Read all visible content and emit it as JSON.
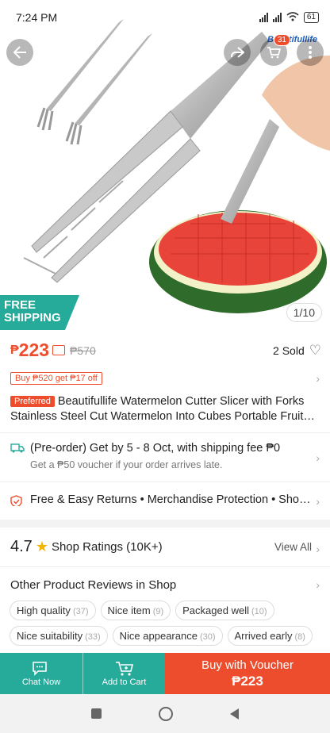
{
  "status_bar": {
    "time": "7:24 PM",
    "battery": "61"
  },
  "header": {
    "cart_count": "31",
    "brand_logo": "Beautifullife"
  },
  "hero": {
    "free_shipping_line1": "FREE",
    "free_shipping_line2": "SHIPPING",
    "image_counter": "1/10"
  },
  "price": {
    "currency": "₱",
    "current": "223",
    "original": "₱570",
    "sold": "2 Sold"
  },
  "voucher_tag": "Buy ₱520 get ₱17 off",
  "product": {
    "badge": "Preferred",
    "title": "Beautifullife Watermelon Cutter Slicer with Forks Stainless Steel Cut Watermelon Into Cubes Portable Fruit Slicer"
  },
  "shipping": {
    "main": "(Pre-order) Get by 5 - 8 Oct, with shipping fee ₱0",
    "sub": "Get a ₱50 voucher if your order arrives late."
  },
  "guarantee": {
    "text": "Free & Easy Returns  •  Merchandise Protection  •  Shopee Guarantee"
  },
  "shop_ratings": {
    "value": "4.7",
    "label": "Shop Ratings (10K+)",
    "view_all": "View All"
  },
  "reviews": {
    "title": "Other Product Reviews in Shop",
    "chips": [
      {
        "label": "High quality",
        "count": "(37)"
      },
      {
        "label": "Nice item",
        "count": "(9)"
      },
      {
        "label": "Packaged well",
        "count": "(10)"
      },
      {
        "label": "Nice suitability",
        "count": "(33)"
      },
      {
        "label": "Nice appearance",
        "count": "(30)"
      },
      {
        "label": "Arrived early",
        "count": "(8)"
      }
    ]
  },
  "bottom_bar": {
    "chat_label": "Chat Now",
    "cart_label": "Add to Cart",
    "buy_label": "Buy with Voucher",
    "buy_price": "₱223"
  },
  "colors": {
    "accent": "#ee4d2d",
    "teal": "#26aa99",
    "star": "#f5b400"
  }
}
